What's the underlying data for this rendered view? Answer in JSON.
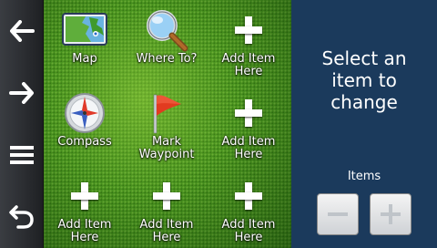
{
  "nav": {
    "back": "back-arrow-icon",
    "forward": "forward-arrow-icon",
    "menu": "menu-icon",
    "return": "return-icon"
  },
  "grid": {
    "tiles": [
      {
        "label": "Map",
        "icon": "map-icon"
      },
      {
        "label": "Where To?",
        "icon": "magnifier-icon"
      },
      {
        "label": "Add Item\nHere",
        "icon": "plus-icon"
      },
      {
        "label": "Compass",
        "icon": "compass-icon"
      },
      {
        "label": "Mark\nWaypoint",
        "icon": "flag-icon"
      },
      {
        "label": "Add Item\nHere",
        "icon": "plus-icon"
      },
      {
        "label": "Add Item\nHere",
        "icon": "plus-icon"
      },
      {
        "label": "Add Item\nHere",
        "icon": "plus-icon"
      },
      {
        "label": "Add Item\nHere",
        "icon": "plus-icon"
      }
    ]
  },
  "panel": {
    "prompt": "Select an\nitem to\nchange",
    "items_label": "Items",
    "minus": "minus-icon",
    "plus": "plus-icon"
  },
  "colors": {
    "panel_bg": "#1b3a5c",
    "grid_bg": "#3e8a1c",
    "sidebar_bg": "#2a2c30"
  }
}
